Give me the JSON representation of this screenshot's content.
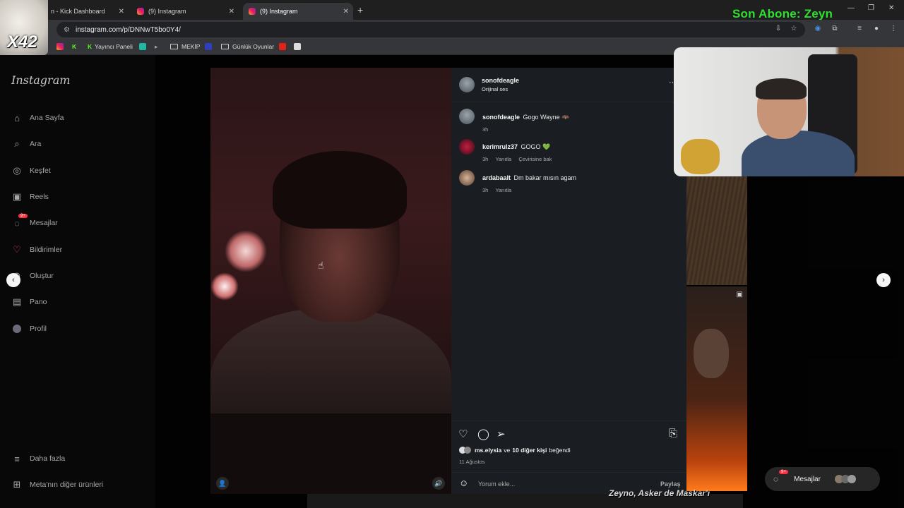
{
  "browser": {
    "tabs": [
      {
        "label": "n - Kick Dashboard"
      },
      {
        "label": "(9) Instagram"
      },
      {
        "label": "(9) Instagram"
      }
    ],
    "url": "instagram.com/p/DNNwT5bo0Y4/",
    "bookmarks": [
      "Yayıncı Paneli",
      "MEKİP",
      "Günlük Oyunlar"
    ]
  },
  "overlay": {
    "sub_banner": "Son Abone: Zeyn",
    "streamer_tag": "X42",
    "bottom_caption": "Zeyno, Asker de Maskar'ı"
  },
  "sidebar": {
    "logo": "Instagram",
    "items": [
      {
        "label": "Ana Sayfa",
        "icon": "home-icon"
      },
      {
        "label": "Ara",
        "icon": "search-icon"
      },
      {
        "label": "Keşfet",
        "icon": "compass-icon"
      },
      {
        "label": "Reels",
        "icon": "reels-icon"
      },
      {
        "label": "Mesajlar",
        "icon": "messenger-icon"
      },
      {
        "label": "Bildirimler",
        "icon": "heart-icon"
      },
      {
        "label": "Oluştur",
        "icon": "plus-icon"
      },
      {
        "label": "Pano",
        "icon": "chart-icon"
      },
      {
        "label": "Profil",
        "icon": "avatar-icon"
      }
    ],
    "more": "Daha fazla",
    "meta": "Meta'nın diğer ürünleri",
    "messages_badge": "9+"
  },
  "post": {
    "author": "sonofdeagle",
    "audio": "Orijinal ses",
    "more_label": "···",
    "caption": {
      "user": "sonofdeagle",
      "text": "Gogo Wayne 🦇",
      "time": "3h"
    },
    "comments": [
      {
        "user": "kerimrulz37",
        "text": "GOGO 💚",
        "time": "3h",
        "reply": "Yanıtla",
        "translate": "Çevirisine bak"
      },
      {
        "user": "ardabaalt",
        "text": "Dm bakar mısın agam",
        "time": "3h",
        "reply": "Yanıtla"
      }
    ],
    "likes": {
      "user": "ms.elysia",
      "connector": "ve",
      "others": "10 diğer kişi",
      "suffix": "beğendi"
    },
    "date": "11 Ağustos",
    "comment_placeholder": "Yorum ekle...",
    "share_label": "Paylaş"
  },
  "floating": {
    "messages_label": "Mesajlar",
    "badge": "9+"
  },
  "colors": {
    "subscriber_green": "#2fe02f",
    "ig_badge_red": "#ff3040",
    "panel_bg": "#1a1d21"
  }
}
